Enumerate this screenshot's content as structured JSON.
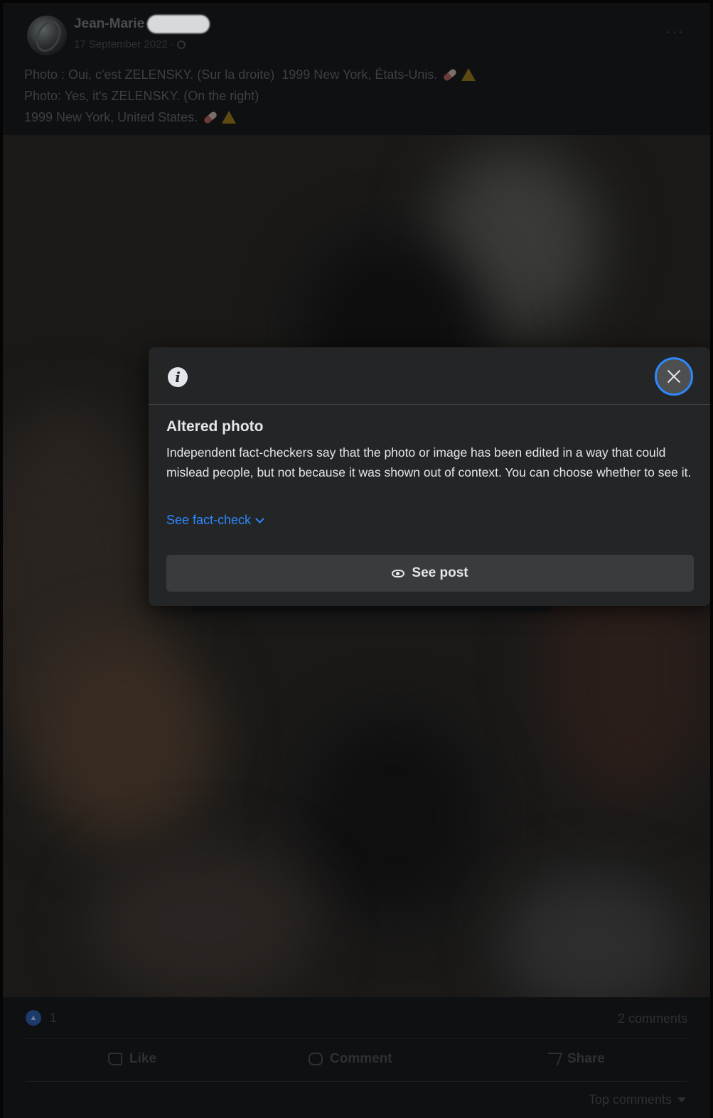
{
  "post": {
    "author": "Jean-Marie",
    "date": "17 September 2022 ·",
    "more_label": "···",
    "caption_lines": [
      "Photo : Oui, c'est ZELENSKY. (Sur la droite)  1999 New York, États-Unis.",
      "Photo: Yes, it's ZELENSKY. (On the right)",
      "1999 New York, United States."
    ]
  },
  "overlay": {
    "title": "Altered photo",
    "body": "Independent fact-checkers say that the photo or image has been edited in a way that could mislead people, but not because it was shown out of context. You can choose whether to see it.",
    "fact_check_link": "See fact-check",
    "see_post_label": "See post",
    "info_glyph": "i"
  },
  "footer": {
    "reaction_count": "1",
    "comments": "2 comments",
    "like": "Like",
    "comment": "Comment",
    "share": "Share",
    "sort": "Top comments"
  },
  "colors": {
    "accent": "#2d88ff",
    "dialog_bg": "#242526",
    "button_bg": "#3a3b3c"
  }
}
